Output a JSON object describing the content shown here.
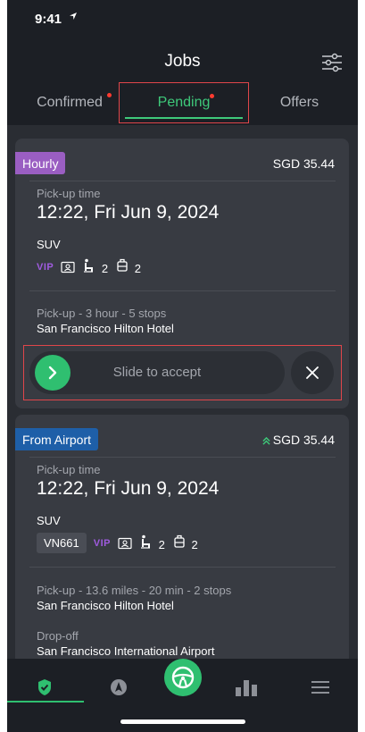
{
  "status_bar": {
    "time": "9:41"
  },
  "header": {
    "title": "Jobs",
    "filter_icon": "sliders-icon"
  },
  "tabs": [
    {
      "label": "Confirmed",
      "has_dot": true,
      "active": false
    },
    {
      "label": "Pending",
      "has_dot": true,
      "active": true
    },
    {
      "label": "Offers",
      "has_dot": false,
      "active": false
    }
  ],
  "jobs": [
    {
      "badge": "Hourly",
      "badge_color": "#9a5ec2",
      "price": "SGD 35.44",
      "pickup_time_label": "Pick-up time",
      "pickup_time": "12:22, Fri Jun 9, 2024",
      "vehicle": "SUV",
      "vip": "VIP",
      "passengers": "2",
      "luggage": "2",
      "route_label": "Pick-up - 3 hour - 5 stops",
      "route_location": "San Francisco Hilton Hotel",
      "slide_label": "Slide to accept"
    },
    {
      "badge": "From Airport",
      "badge_color": "#1e5fa8",
      "price": "SGD 35.44",
      "pickup_time_label": "Pick-up time",
      "pickup_time": "12:22, Fri Jun 9, 2024",
      "vehicle": "SUV",
      "flight": "VN661",
      "vip": "VIP",
      "passengers": "2",
      "luggage": "2",
      "route_label": "Pick-up - 13.6 miles - 20 min - 2 stops",
      "route_location": "San Francisco Hilton Hotel",
      "dropoff_label": "Drop-off",
      "dropoff_location": "San Francisco International Airport"
    }
  ],
  "bottom_nav": {
    "items": [
      "jobs-icon",
      "navigation-icon",
      "steering-wheel-icon",
      "stats-icon",
      "menu-icon"
    ],
    "accent": "#2fbf70"
  }
}
